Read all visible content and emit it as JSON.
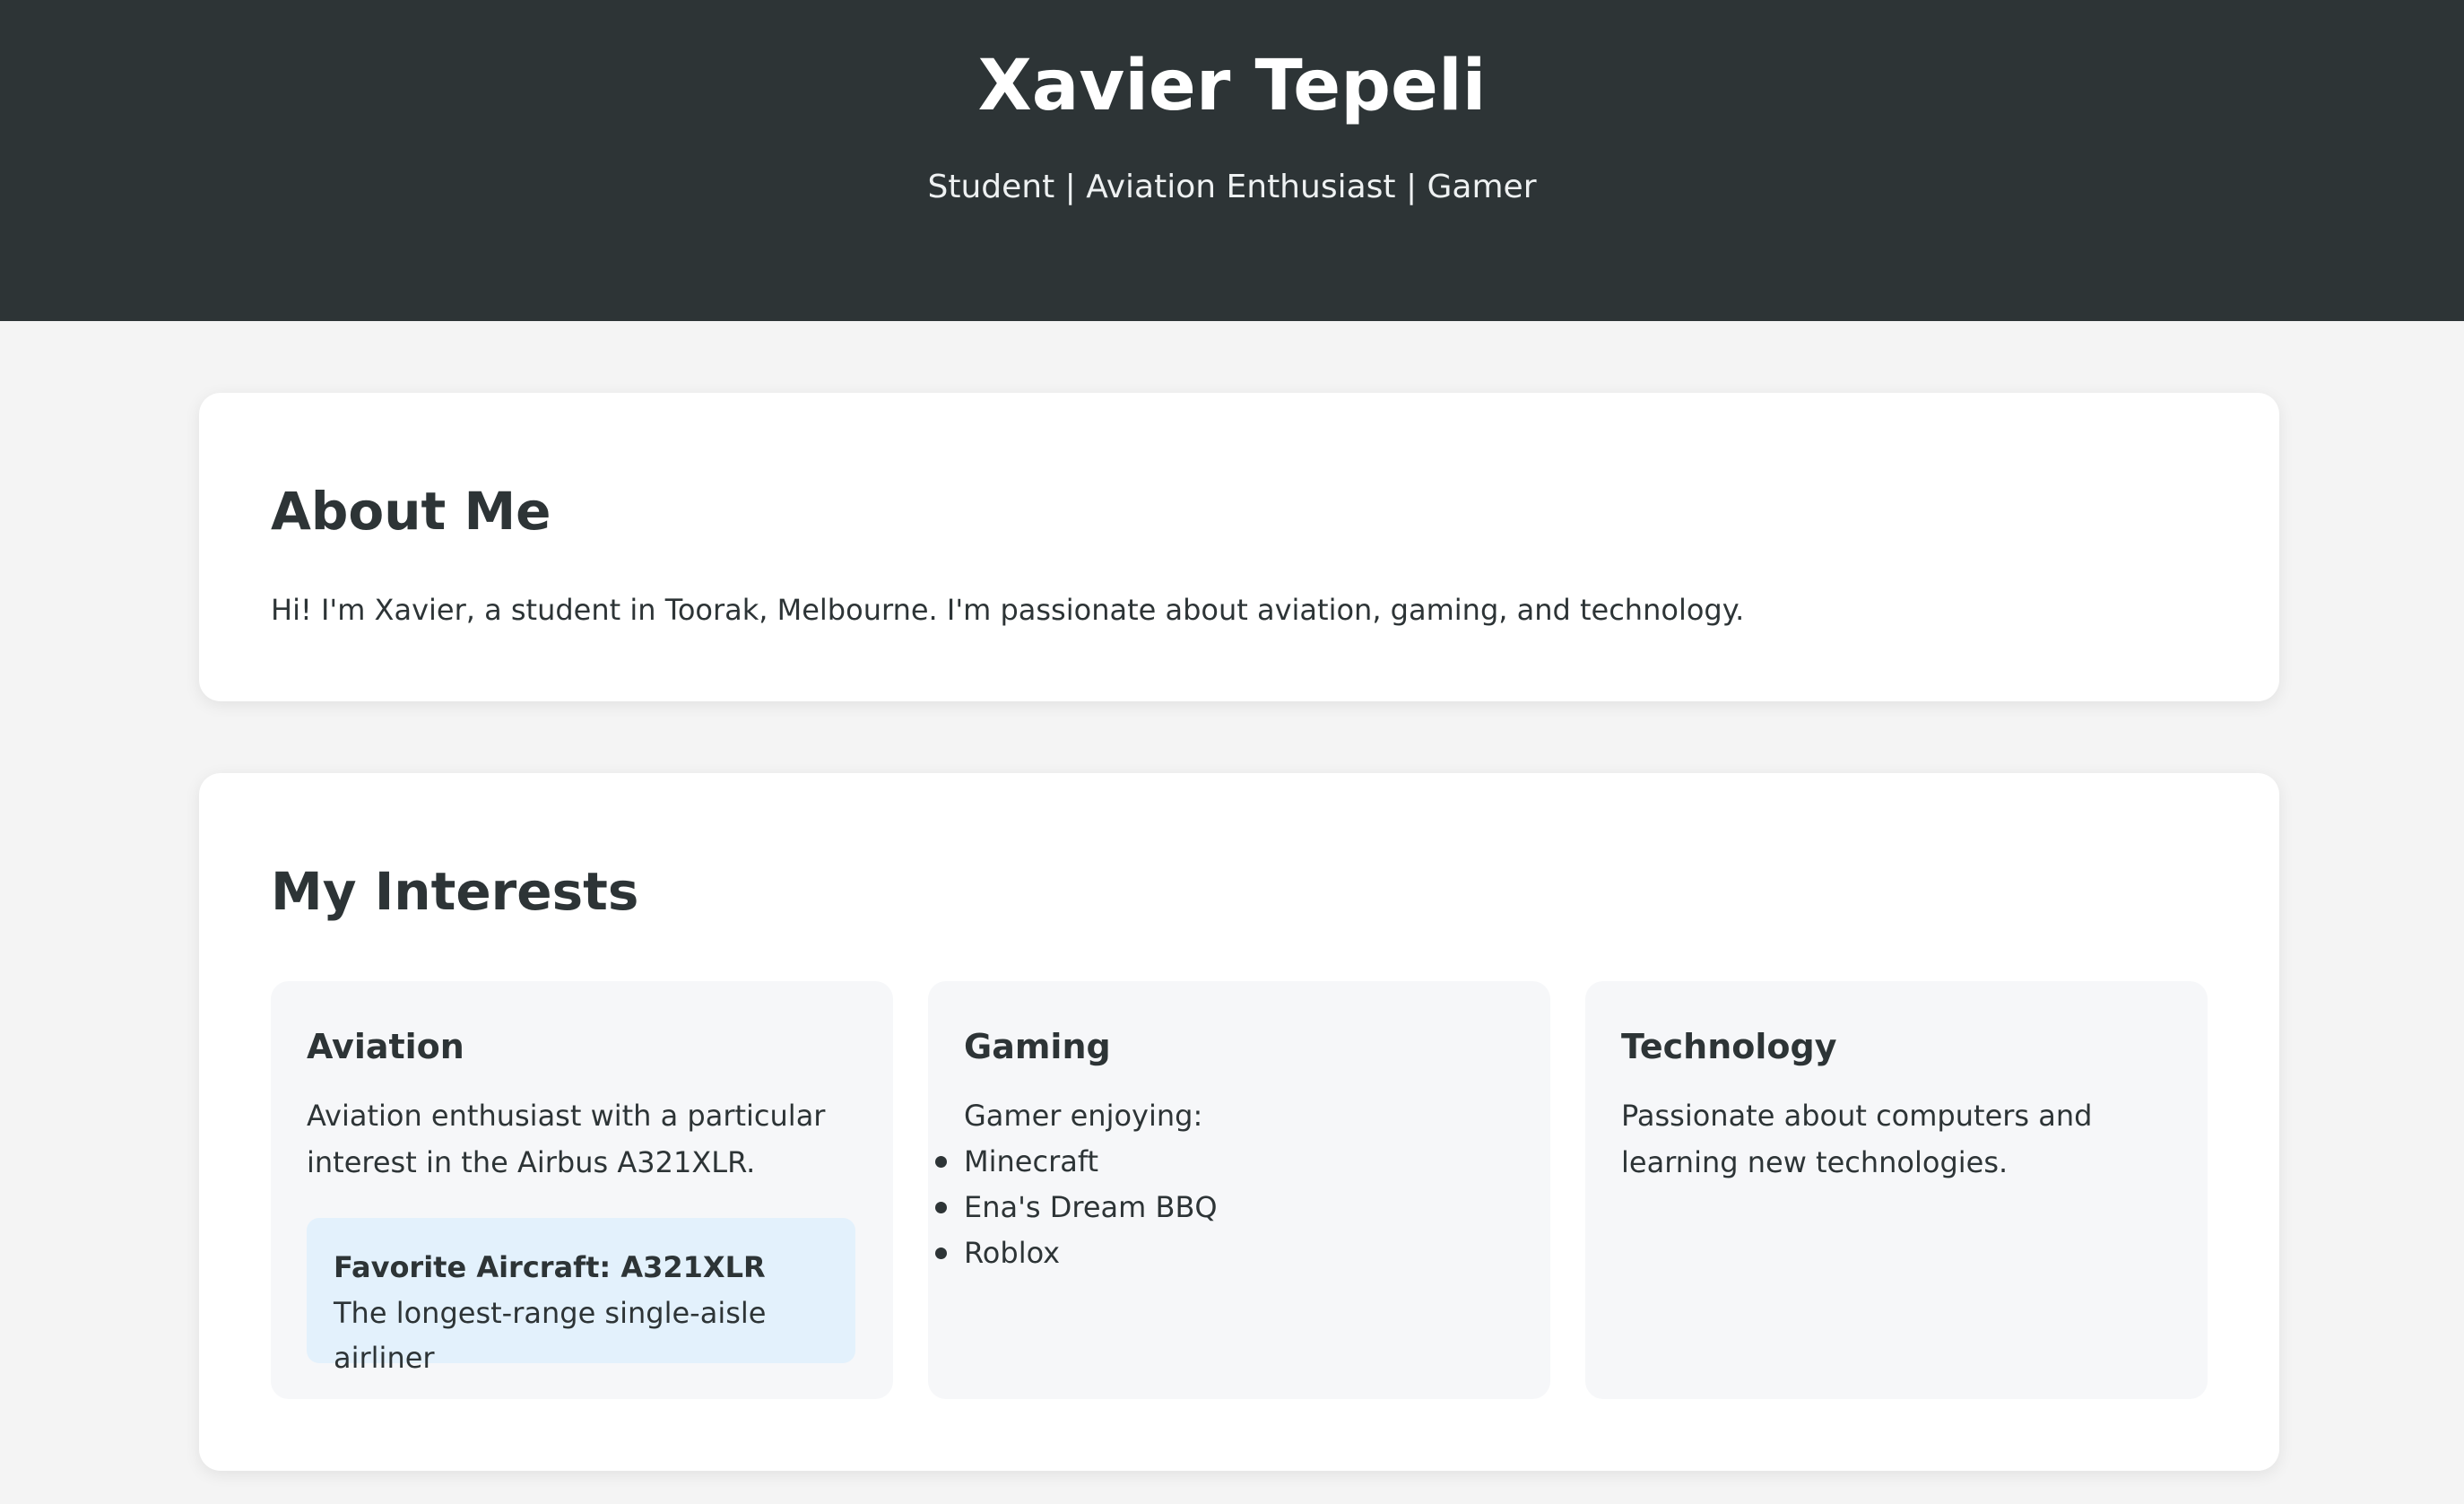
{
  "header": {
    "name": "Xavier Tepeli",
    "tagline": "Student | Aviation Enthusiast | Gamer"
  },
  "about": {
    "title": "About Me",
    "text": "Hi! I'm Xavier, a student in Toorak, Melbourne. I'm passionate about aviation, gaming, and technology."
  },
  "interests": {
    "title": "My Interests",
    "aviation": {
      "title": "Aviation",
      "text": "Aviation enthusiast with a particular interest in the Airbus A321XLR.",
      "favorite": {
        "title": "Favorite Aircraft: A321XLR",
        "description": "The longest-range single-aisle airliner"
      }
    },
    "gaming": {
      "title": "Gaming",
      "intro": "Gamer enjoying:",
      "games": [
        "Minecraft",
        "Ena's Dream BBQ",
        "Roblox"
      ]
    },
    "technology": {
      "title": "Technology",
      "text": "Passionate about computers and learning new technologies."
    }
  },
  "colors": {
    "header_bg": "#2d3436",
    "page_bg": "#f4f4f4",
    "card_bg": "#ffffff",
    "interest_bg": "#f6f7f9",
    "highlight_bg": "#e3f1fc"
  }
}
